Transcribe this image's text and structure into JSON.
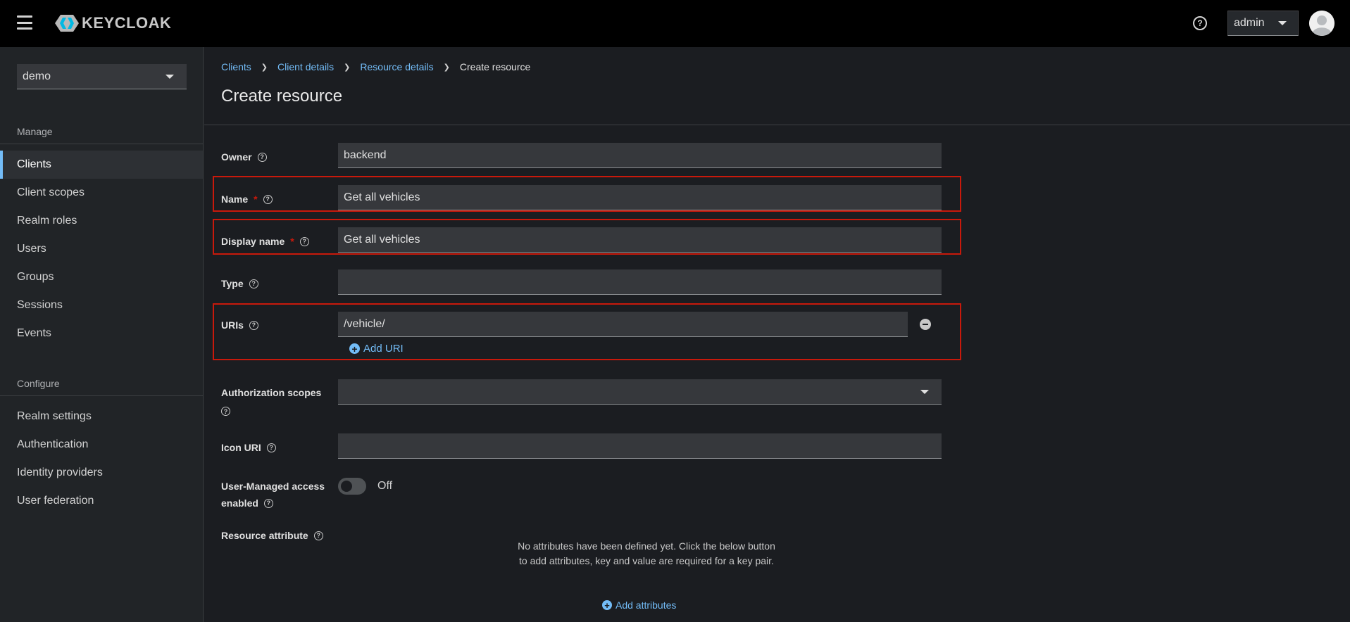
{
  "header": {
    "logo_text": "KEYCLOAK",
    "help_glyph": "?",
    "user_label": "admin"
  },
  "sidebar": {
    "realm": "demo",
    "manage_label": "Manage",
    "manage_items": [
      {
        "label": "Clients",
        "active": true
      },
      {
        "label": "Client scopes"
      },
      {
        "label": "Realm roles"
      },
      {
        "label": "Users"
      },
      {
        "label": "Groups"
      },
      {
        "label": "Sessions"
      },
      {
        "label": "Events"
      }
    ],
    "configure_label": "Configure",
    "configure_items": [
      {
        "label": "Realm settings"
      },
      {
        "label": "Authentication"
      },
      {
        "label": "Identity providers"
      },
      {
        "label": "User federation"
      }
    ]
  },
  "breadcrumb": [
    "Clients",
    "Client details",
    "Resource details",
    "Create resource"
  ],
  "page_title": "Create resource",
  "form": {
    "owner_label": "Owner",
    "owner_value": "backend",
    "name_label": "Name",
    "name_value": "Get all vehicles",
    "display_name_label": "Display name",
    "display_name_value": "Get all vehicles",
    "required_mark": "*",
    "type_label": "Type",
    "type_value": "",
    "uris_label": "URIs",
    "uri_value": "/vehicle/",
    "add_uri_label": "Add URI",
    "auth_scopes_label": "Authorization scopes",
    "icon_uri_label": "Icon URI",
    "icon_uri_value": "",
    "uma_label_line1": "User-Managed access",
    "uma_label_line2": "enabled",
    "uma_state": "Off",
    "resource_attribute_label": "Resource attribute",
    "empty_attributes_text": "No attributes have been defined yet. Click the below button to add attributes, key and value are required for a key pair.",
    "add_attributes_label": "Add attributes"
  },
  "colors": {
    "accent": "#73bcf7",
    "highlight": "#c9190b",
    "background": "#1b1d21"
  }
}
